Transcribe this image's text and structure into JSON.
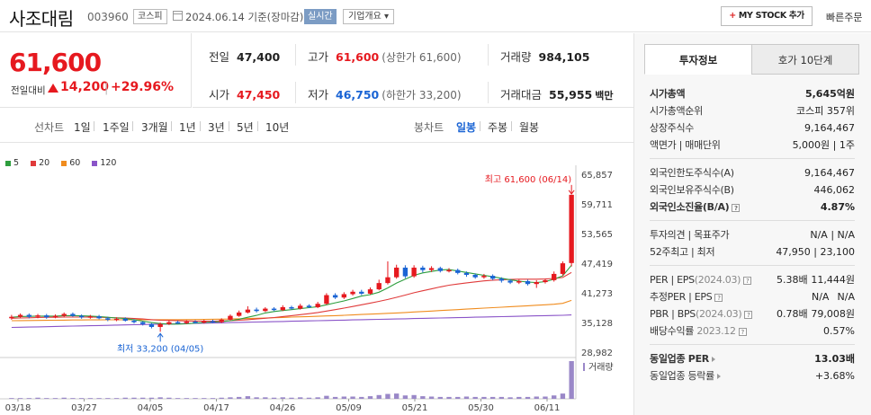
{
  "header": {
    "stock_name": "사조대림",
    "stock_code": "003960",
    "market": "코스피",
    "date_text": "2024.06.14 기준(장마감)",
    "realtime_label": "실시간",
    "overview_label": "기업개요 ▾",
    "mystock_label": "MY STOCK 추가",
    "quick_order_label": "빠른주문"
  },
  "price": {
    "current": "61,600",
    "vs_label": "전일대비",
    "change": "14,200",
    "sep": "|",
    "percent": "+29.96%"
  },
  "stats": {
    "prev_label": "전일",
    "prev_value": "47,400",
    "high_label": "고가",
    "high_value": "61,600",
    "high_sub": "(상한가 61,600)",
    "volume_label": "거래량",
    "volume_value": "984,105",
    "open_label": "시가",
    "open_value": "47,450",
    "low_label": "저가",
    "low_value": "46,750",
    "low_sub": "(하한가 33,200)",
    "amount_label": "거래대금",
    "amount_value": "55,955",
    "amount_unit": "백만"
  },
  "period_bar": {
    "line_label": "선차트",
    "line_options": [
      "1일",
      "1주일",
      "3개월",
      "1년",
      "3년",
      "5년",
      "10년"
    ],
    "candle_label": "봉차트",
    "candle_options": [
      "일봉",
      "주봉",
      "월봉"
    ],
    "candle_selected": "일봉"
  },
  "chart_data": {
    "type": "candlestick",
    "legend": [
      {
        "name": "5",
        "color": "#2e9e3e"
      },
      {
        "name": "20",
        "color": "#e03a3a"
      },
      {
        "name": "60",
        "color": "#f08c1e"
      },
      {
        "name": "120",
        "color": "#8a54c8"
      }
    ],
    "y_ticks": [
      "65,857",
      "59,711",
      "53,565",
      "47,419",
      "41,273",
      "35,128",
      "28,982"
    ],
    "ylim": [
      28982,
      65857
    ],
    "x_ticks": [
      "03/18",
      "03/27",
      "04/05",
      "04/17",
      "04/26",
      "05/09",
      "05/21",
      "05/30",
      "06/11"
    ],
    "high_annotation": "최고 61,600 (06/14)",
    "low_annotation": "최저 33,200 (04/05)",
    "volume_label": "거래량",
    "candles": [
      {
        "o": 36000,
        "c": 36300,
        "h": 36700,
        "l": 35700
      },
      {
        "o": 36300,
        "c": 36700,
        "h": 37000,
        "l": 36000
      },
      {
        "o": 36700,
        "c": 36300,
        "h": 37000,
        "l": 36000
      },
      {
        "o": 36300,
        "c": 36600,
        "h": 36900,
        "l": 36000
      },
      {
        "o": 36600,
        "c": 36200,
        "h": 36900,
        "l": 35900
      },
      {
        "o": 36200,
        "c": 36500,
        "h": 36800,
        "l": 36000
      },
      {
        "o": 36500,
        "c": 36900,
        "h": 37200,
        "l": 36200
      },
      {
        "o": 36900,
        "c": 36500,
        "h": 37200,
        "l": 36300
      },
      {
        "o": 36500,
        "c": 36200,
        "h": 36800,
        "l": 35900
      },
      {
        "o": 36200,
        "c": 36400,
        "h": 36700,
        "l": 35900
      },
      {
        "o": 36400,
        "c": 36000,
        "h": 36700,
        "l": 35800
      },
      {
        "o": 36000,
        "c": 35700,
        "h": 36300,
        "l": 35400
      },
      {
        "o": 35700,
        "c": 35900,
        "h": 36200,
        "l": 35400
      },
      {
        "o": 35900,
        "c": 35500,
        "h": 36200,
        "l": 35300
      },
      {
        "o": 35500,
        "c": 35200,
        "h": 35800,
        "l": 34900
      },
      {
        "o": 35200,
        "c": 34800,
        "h": 35400,
        "l": 34500
      },
      {
        "o": 34800,
        "c": 34200,
        "h": 35000,
        "l": 33900
      },
      {
        "o": 34200,
        "c": 34800,
        "h": 35100,
        "l": 33200
      },
      {
        "o": 34800,
        "c": 35200,
        "h": 35500,
        "l": 34600
      },
      {
        "o": 35200,
        "c": 35000,
        "h": 35500,
        "l": 34800
      },
      {
        "o": 35000,
        "c": 35300,
        "h": 35600,
        "l": 34800
      },
      {
        "o": 35300,
        "c": 35100,
        "h": 35600,
        "l": 34900
      },
      {
        "o": 35100,
        "c": 35400,
        "h": 35700,
        "l": 34900
      },
      {
        "o": 35400,
        "c": 35200,
        "h": 35700,
        "l": 35000
      },
      {
        "o": 35200,
        "c": 35700,
        "h": 36000,
        "l": 35000
      },
      {
        "o": 35700,
        "c": 36500,
        "h": 36800,
        "l": 35500
      },
      {
        "o": 36500,
        "c": 37200,
        "h": 37600,
        "l": 36300
      },
      {
        "o": 37200,
        "c": 37800,
        "h": 38500,
        "l": 37000
      },
      {
        "o": 37800,
        "c": 37500,
        "h": 38200,
        "l": 37200
      },
      {
        "o": 37500,
        "c": 38000,
        "h": 38300,
        "l": 37300
      },
      {
        "o": 38000,
        "c": 37700,
        "h": 38300,
        "l": 37500
      },
      {
        "o": 37700,
        "c": 38300,
        "h": 38700,
        "l": 37500
      },
      {
        "o": 38300,
        "c": 38000,
        "h": 38600,
        "l": 37800
      },
      {
        "o": 38000,
        "c": 38600,
        "h": 39000,
        "l": 37800
      },
      {
        "o": 38600,
        "c": 38300,
        "h": 38900,
        "l": 38100
      },
      {
        "o": 38300,
        "c": 39000,
        "h": 39400,
        "l": 38100
      },
      {
        "o": 39000,
        "c": 40800,
        "h": 41200,
        "l": 38800
      },
      {
        "o": 40800,
        "c": 40300,
        "h": 41200,
        "l": 40000
      },
      {
        "o": 40300,
        "c": 41000,
        "h": 41400,
        "l": 40000
      },
      {
        "o": 41000,
        "c": 41500,
        "h": 41900,
        "l": 40700
      },
      {
        "o": 41500,
        "c": 41100,
        "h": 41900,
        "l": 40800
      },
      {
        "o": 41100,
        "c": 42000,
        "h": 42400,
        "l": 40900
      },
      {
        "o": 42000,
        "c": 43300,
        "h": 44000,
        "l": 41800
      },
      {
        "o": 43300,
        "c": 44500,
        "h": 47800,
        "l": 43000
      },
      {
        "o": 44500,
        "c": 46500,
        "h": 47100,
        "l": 44200
      },
      {
        "o": 46500,
        "c": 44700,
        "h": 47000,
        "l": 44300
      },
      {
        "o": 44700,
        "c": 46500,
        "h": 47000,
        "l": 44400
      },
      {
        "o": 46500,
        "c": 46000,
        "h": 46900,
        "l": 45500
      },
      {
        "o": 46000,
        "c": 46400,
        "h": 46800,
        "l": 45600
      },
      {
        "o": 46400,
        "c": 45800,
        "h": 46700,
        "l": 45500
      },
      {
        "o": 45800,
        "c": 46000,
        "h": 46400,
        "l": 45500
      },
      {
        "o": 46000,
        "c": 45400,
        "h": 46300,
        "l": 45100
      },
      {
        "o": 45400,
        "c": 45000,
        "h": 45700,
        "l": 44600
      },
      {
        "o": 45000,
        "c": 44500,
        "h": 45300,
        "l": 44200
      },
      {
        "o": 44500,
        "c": 44800,
        "h": 45200,
        "l": 44200
      },
      {
        "o": 44800,
        "c": 44200,
        "h": 45100,
        "l": 43900
      },
      {
        "o": 44200,
        "c": 43800,
        "h": 44500,
        "l": 43400
      },
      {
        "o": 43800,
        "c": 43400,
        "h": 44100,
        "l": 43100
      },
      {
        "o": 43400,
        "c": 43700,
        "h": 44000,
        "l": 43100
      },
      {
        "o": 43700,
        "c": 43100,
        "h": 44000,
        "l": 42800
      },
      {
        "o": 43100,
        "c": 43500,
        "h": 43900,
        "l": 42300
      },
      {
        "o": 43500,
        "c": 43900,
        "h": 44200,
        "l": 43200
      },
      {
        "o": 43900,
        "c": 45200,
        "h": 45700,
        "l": 43600
      },
      {
        "o": 45200,
        "c": 47400,
        "h": 47800,
        "l": 44800
      },
      {
        "o": 47450,
        "c": 61600,
        "h": 61600,
        "l": 46750
      }
    ],
    "ma5": [
      36200,
      36350,
      36400,
      36450,
      36450,
      36450,
      36550,
      36550,
      36500,
      36450,
      36350,
      36200,
      36050,
      35950,
      35700,
      35400,
      35100,
      34900,
      34800,
      34800,
      34850,
      35000,
      35150,
      35200,
      35300,
      35500,
      35800,
      36200,
      36600,
      37100,
      37400,
      37600,
      37800,
      38000,
      38200,
      38400,
      38800,
      39200,
      39600,
      40100,
      40600,
      40900,
      41400,
      42300,
      43300,
      44100,
      44900,
      45400,
      45700,
      46000,
      46100,
      45800,
      45500,
      45200,
      44900,
      44600,
      44300,
      44000,
      43700,
      43500,
      43400,
      43600,
      44100,
      44800,
      47000
    ],
    "ma20": [
      36000,
      36050,
      36100,
      36150,
      36200,
      36200,
      36250,
      36250,
      36250,
      36250,
      36200,
      36150,
      36100,
      36050,
      35950,
      35850,
      35700,
      35600,
      35550,
      35500,
      35450,
      35400,
      35400,
      35400,
      35450,
      35500,
      35600,
      35700,
      35850,
      36000,
      36150,
      36350,
      36550,
      36750,
      36950,
      37200,
      37500,
      37800,
      38100,
      38450,
      38800,
      39150,
      39500,
      39900,
      40350,
      40800,
      41300,
      41700,
      42100,
      42500,
      42850,
      43100,
      43350,
      43550,
      43750,
      43900,
      44000,
      44050,
      44100,
      44100,
      44100,
      44150,
      44250,
      44450,
      45500
    ],
    "ma60": [
      35500,
      35520,
      35540,
      35560,
      35580,
      35600,
      35620,
      35640,
      35650,
      35660,
      35670,
      35680,
      35690,
      35700,
      35700,
      35700,
      35700,
      35700,
      35700,
      35710,
      35720,
      35740,
      35760,
      35790,
      35820,
      35860,
      35900,
      35950,
      36000,
      36060,
      36120,
      36180,
      36240,
      36300,
      36360,
      36420,
      36480,
      36550,
      36620,
      36700,
      36780,
      36860,
      36940,
      37020,
      37110,
      37200,
      37300,
      37400,
      37500,
      37600,
      37700,
      37800,
      37900,
      38000,
      38100,
      38200,
      38300,
      38400,
      38500,
      38600,
      38700,
      38800,
      38900,
      39100,
      39700
    ],
    "ma120": [
      34100,
      34140,
      34180,
      34220,
      34260,
      34300,
      34340,
      34380,
      34420,
      34460,
      34500,
      34540,
      34580,
      34620,
      34660,
      34700,
      34740,
      34780,
      34820,
      34860,
      34900,
      34940,
      34980,
      35020,
      35060,
      35100,
      35140,
      35180,
      35220,
      35260,
      35300,
      35340,
      35380,
      35420,
      35460,
      35500,
      35540,
      35580,
      35620,
      35660,
      35700,
      35740,
      35780,
      35820,
      35860,
      35900,
      35940,
      35980,
      36020,
      36060,
      36100,
      36140,
      36180,
      36220,
      36260,
      36300,
      36340,
      36380,
      36420,
      36460,
      36500,
      36540,
      36580,
      36620,
      36700
    ],
    "volume": [
      0.02,
      0.02,
      0.02,
      0.03,
      0.02,
      0.02,
      0.03,
      0.02,
      0.02,
      0.02,
      0.02,
      0.02,
      0.02,
      0.03,
      0.03,
      0.03,
      0.03,
      0.04,
      0.03,
      0.02,
      0.02,
      0.02,
      0.02,
      0.02,
      0.03,
      0.04,
      0.05,
      0.07,
      0.04,
      0.04,
      0.03,
      0.04,
      0.03,
      0.04,
      0.03,
      0.04,
      0.08,
      0.05,
      0.06,
      0.06,
      0.05,
      0.07,
      0.1,
      0.13,
      0.14,
      0.09,
      0.1,
      0.07,
      0.06,
      0.05,
      0.05,
      0.05,
      0.06,
      0.05,
      0.05,
      0.05,
      0.05,
      0.04,
      0.05,
      0.05,
      0.06,
      0.06,
      0.09,
      0.14,
      1.0
    ]
  },
  "right_panel": {
    "tab_active": "투자정보",
    "tab_inactive": "호가 10단계",
    "rows": {
      "mcap_label": "시가총액",
      "mcap_value": "5,645억원",
      "rank_label": "시가총액순위",
      "rank_value": "코스피 357위",
      "shares_label": "상장주식수",
      "shares_value": "9,164,467",
      "par_label": "액면가 | 매매단위",
      "par_value": "5,000원 | 1주",
      "fl_limit_label": "외국인한도주식수(A)",
      "fl_limit_value": "9,164,467",
      "fl_hold_label": "외국인보유주식수(B)",
      "fl_hold_value": "446,062",
      "fl_ratio_label": "외국인소진율(B/A)",
      "fl_ratio_value": "4.87%",
      "opinion_label": "투자의견 | 목표주가",
      "opinion_value": "N/A | N/A",
      "w52_label": "52주최고 | 최저",
      "w52_value": "47,950 | 23,100",
      "per_label": "PER | EPS",
      "per_date": "(2024.03)",
      "per_value": "5.38배",
      "eps_value": "11,444원",
      "eper_label": "추정PER | EPS",
      "eper_value": "N/A",
      "eeps_value": "N/A",
      "pbr_label": "PBR | BPS",
      "pbr_date": "(2024.03)",
      "pbr_value": "0.78배",
      "bps_value": "79,008원",
      "div_label": "배당수익률",
      "div_date": "2023.12",
      "div_value": "0.57%",
      "ind_per_label": "동일업종 PER",
      "ind_per_value": "13.03배",
      "ind_rate_label": "동일업종 등락률",
      "ind_rate_value": "+3.68%"
    }
  }
}
